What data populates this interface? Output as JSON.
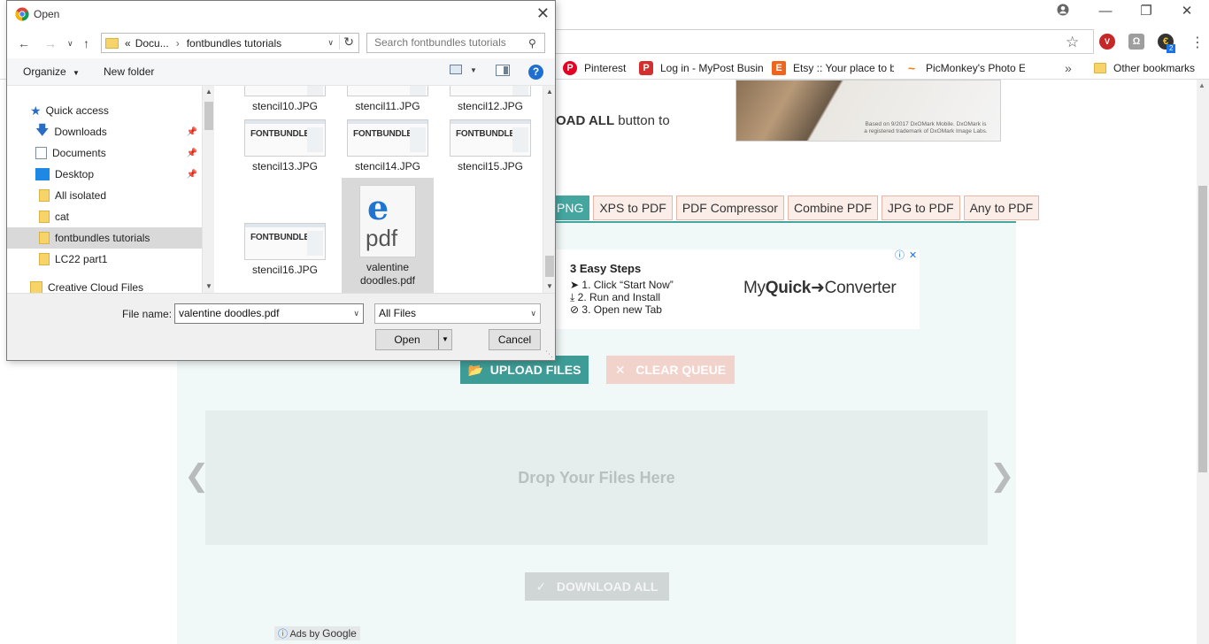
{
  "browser": {
    "bookmarks": [
      {
        "label": "Pinterest",
        "color": "#e60023",
        "glyph": "P"
      },
      {
        "label": "Log in - MyPost Busin",
        "color": "#d32f2f",
        "glyph": "P"
      },
      {
        "label": "Etsy :: Your place to b",
        "color": "#f1641e",
        "glyph": "E"
      },
      {
        "label": "PicMonkey's Photo E",
        "color": "#f57c00",
        "glyph": "~"
      }
    ],
    "bookmarks_more": "»",
    "other_bookmarks": "Other bookmarks",
    "extension_badge": "2"
  },
  "page": {
    "intro_bold": "OAD ALL",
    "intro_rest": " button to",
    "banner_note": "Based on 9/2017 DxOMark Mobile. DxOMark is a registered trademark of DxOMark Image Labs.",
    "tabs": [
      "PNG",
      "XPS to PDF",
      "PDF Compressor",
      "Combine PDF",
      "JPG to PDF",
      "Any to PDF"
    ],
    "ad": {
      "title": "3 Easy Steps",
      "steps": [
        "1. Click “Start Now”",
        "2. Run and Install",
        "3. Open new Tab"
      ],
      "brand_pre": "My",
      "brand_bold": "Quick",
      "brand_arrow": "➜",
      "brand_post": "Converter"
    },
    "upload_label": "UPLOAD FILES",
    "clear_label": "CLEAR QUEUE",
    "drop_label": "Drop Your Files Here",
    "download_label": "DOWNLOAD ALL",
    "ads_by": "Ads by",
    "ads_brand": "Google",
    "colors": {
      "accent": "#45a6a0",
      "tab_bg": "#fbeee9",
      "panel_bg": "#f1f8f8"
    }
  },
  "dialog": {
    "title": "Open",
    "breadcrumb_prefix": "«",
    "breadcrumb": [
      "Docu...",
      "fontbundles tutorials"
    ],
    "search_placeholder": "Search fontbundles tutorials",
    "organize": "Organize",
    "new_folder": "New folder",
    "nav": [
      {
        "label": "Quick access",
        "icon": "star-icon",
        "pinned": false,
        "selected": false
      },
      {
        "label": "Downloads",
        "icon": "download-icon",
        "pinned": true,
        "selected": false
      },
      {
        "label": "Documents",
        "icon": "document-icon",
        "pinned": true,
        "selected": false
      },
      {
        "label": "Desktop",
        "icon": "desktop-icon",
        "pinned": true,
        "selected": false
      },
      {
        "label": "All isolated",
        "icon": "folder-icon",
        "pinned": false,
        "selected": false
      },
      {
        "label": "cat",
        "icon": "folder-icon",
        "pinned": false,
        "selected": false
      },
      {
        "label": "fontbundles tutorials",
        "icon": "folder-icon",
        "pinned": false,
        "selected": true
      },
      {
        "label": "LC22 part1",
        "icon": "folder-icon",
        "pinned": false,
        "selected": false
      },
      {
        "label": "Creative Cloud Files",
        "icon": "creative-cloud-icon",
        "pinned": false,
        "selected": false
      }
    ],
    "files": [
      {
        "name": "stencil10.JPG",
        "kind": "jpg"
      },
      {
        "name": "stencil11.JPG",
        "kind": "jpg"
      },
      {
        "name": "stencil12.JPG",
        "kind": "jpg"
      },
      {
        "name": "stencil13.JPG",
        "kind": "jpg"
      },
      {
        "name": "stencil14.JPG",
        "kind": "jpg"
      },
      {
        "name": "stencil15.JPG",
        "kind": "jpg"
      },
      {
        "name": "stencil16.JPG",
        "kind": "jpg"
      },
      {
        "name": "valentine doodles.pdf",
        "kind": "pdf",
        "selected": true
      }
    ],
    "thumb_brand": "FONTBUNDLES",
    "pdf_label": "pdf",
    "file_name_label": "File name:",
    "file_name_value": "valentine doodles.pdf",
    "file_type": "All Files",
    "open_label": "Open",
    "cancel_label": "Cancel"
  }
}
